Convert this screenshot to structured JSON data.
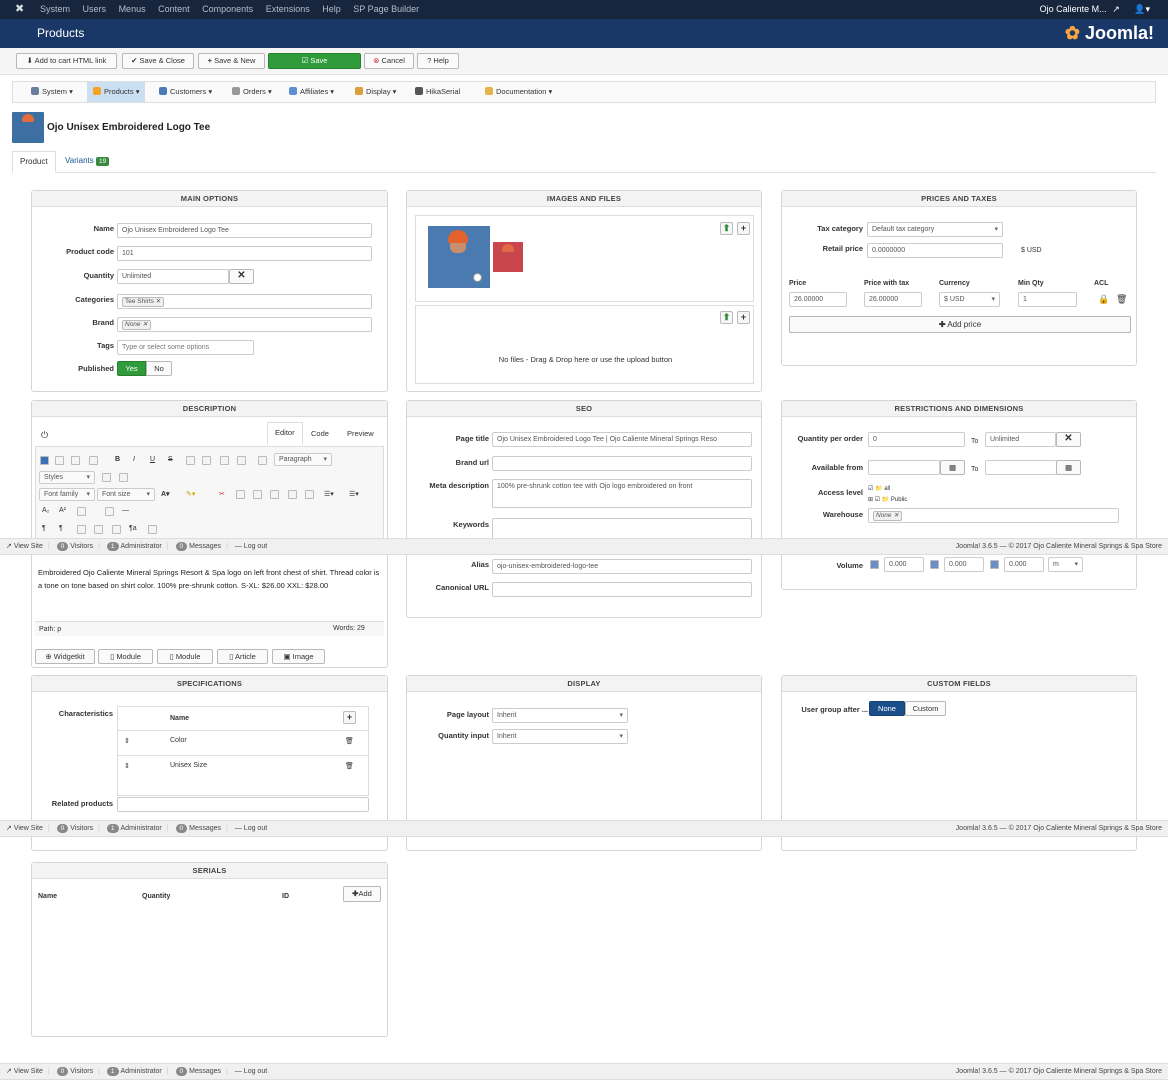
{
  "topnav": {
    "items": [
      "System",
      "Users",
      "Menus",
      "Content",
      "Components",
      "Extensions",
      "Help",
      "SP Page Builder"
    ],
    "user": "Ojo Caliente M..."
  },
  "titlebar": {
    "title": "Products",
    "brand": "Joomla!"
  },
  "toolbar": {
    "add_to_cart": "Add to cart HTML link",
    "save_close": "Save & Close",
    "save_new": "Save & New",
    "save": "Save",
    "cancel": "Cancel",
    "help": "Help"
  },
  "hikanav": {
    "items": [
      "System",
      "Products",
      "Customers",
      "Orders",
      "Affiliates",
      "Display",
      "HikaSerial",
      "Documentation"
    ]
  },
  "product": {
    "title": "Ojo Unisex Embroidered Logo Tee"
  },
  "tabs": {
    "product": "Product",
    "variants": "Variants",
    "variants_count": "19"
  },
  "main_options": {
    "heading": "MAIN OPTIONS",
    "name_label": "Name",
    "name": "Ojo Unisex Embroidered Logo Tee",
    "code_label": "Product code",
    "code": "101",
    "quantity_label": "Quantity",
    "quantity": "Unlimited",
    "categories_label": "Categories",
    "category_tag": "Tee Shirts",
    "brand_label": "Brand",
    "brand_tag": "None",
    "tags_label": "Tags",
    "tags_placeholder": "Type or select some options",
    "published_label": "Published",
    "yes": "Yes",
    "no": "No"
  },
  "images": {
    "heading": "IMAGES AND FILES",
    "no_files": "No files - Drag & Drop here or use the upload button"
  },
  "prices": {
    "heading": "PRICES AND TAXES",
    "tax_label": "Tax category",
    "tax_value": "Default tax category",
    "retail_label": "Retail price",
    "retail_value": "0.0000000",
    "retail_currency": "$ USD",
    "col_price": "Price",
    "col_price_tax": "Price with tax",
    "col_currency": "Currency",
    "col_min_qty": "Min Qty",
    "col_acl": "ACL",
    "price": "26.00000",
    "price_tax": "26.00000",
    "currency": "$ USD",
    "min_qty": "1",
    "add_price": "Add price"
  },
  "description": {
    "heading": "DESCRIPTION",
    "tab_editor": "Editor",
    "tab_code": "Code",
    "tab_preview": "Preview",
    "styles": "Styles",
    "paragraph": "Paragraph",
    "font_family": "Font family",
    "font_size": "Font size",
    "text": "Embroidered Ojo Caliente Mineral Springs Resort & Spa logo on left front chest of shirt. Thread color is a tone on tone based on shirt color. 100% pre-shrunk cotton. S-XL: $26.00 XXL: $28.00",
    "path": "Path: p",
    "words": "Words: 29",
    "btns": [
      "Widgetkit",
      "Module",
      "Module",
      "Article",
      "Image"
    ]
  },
  "seo": {
    "heading": "SEO",
    "page_title_label": "Page title",
    "page_title": "Ojo Unisex Embroidered Logo Tee | Ojo Caliente Mineral Springs Reso",
    "brand_url_label": "Brand url",
    "meta_label": "Meta description",
    "meta": "100% pre-shrunk cotton tee with Ojo logo embroidered on front",
    "keywords_label": "Keywords",
    "alias_label": "Alias",
    "alias": "ojo-unisex-embroidered-logo-tee",
    "canonical_label": "Canonical URL"
  },
  "restrictions": {
    "heading": "RESTRICTIONS AND DIMENSIONS",
    "qty_label": "Quantity per order",
    "qty_from": "0",
    "to": "To",
    "qty_to": "Unlimited",
    "avail_label": "Available from",
    "access_label": "Access level",
    "access_all": "all",
    "access_public": "Public",
    "warehouse_label": "Warehouse",
    "warehouse_tag": "None",
    "volume_label": "Volume",
    "v1": "0.000",
    "v2": "0.000",
    "v3": "0.000",
    "unit": "m"
  },
  "specifications": {
    "heading": "SPECIFICATIONS",
    "char_label": "Characteristics",
    "col_name": "Name",
    "rows": [
      "Color",
      "Unisex Size"
    ],
    "related_label": "Related products"
  },
  "display": {
    "heading": "DISPLAY",
    "layout_label": "Page layout",
    "layout": "Inherit",
    "qinput_label": "Quantity input",
    "qinput": "Inherit"
  },
  "custom_fields": {
    "heading": "CUSTOM FIELDS",
    "label": "User group after ...",
    "none": "None",
    "custom": "Custom"
  },
  "serials": {
    "heading": "SERIALS",
    "col_name": "Name",
    "col_quantity": "Quantity",
    "col_id": "ID",
    "add": "Add"
  },
  "status": {
    "view_site": "View Site",
    "visitors": "Visitors",
    "visitors_count": "0",
    "admin": "Administrator",
    "admin_count": "1",
    "messages": "Messages",
    "messages_count": "0",
    "logout": "Log out",
    "copyright": "Joomla! 3.6.5 — © 2017 Ojo Caliente Mineral Springs & Spa Store"
  },
  "colors": {
    "navy": "#17263c",
    "title_blue": "#1a3867",
    "green": "#2f9b3a",
    "accent_blue": "#1a5496"
  }
}
